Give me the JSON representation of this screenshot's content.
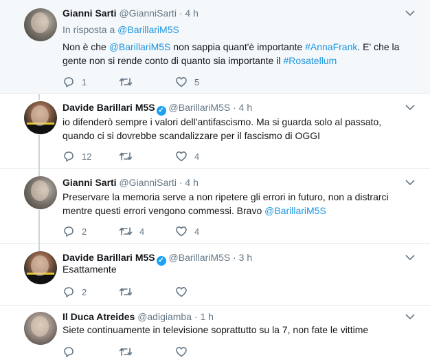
{
  "tweets": [
    {
      "name": "Gianni Sarti",
      "handle": "@GianniSarti",
      "time": "4 h",
      "reply_prefix": "In risposta a",
      "reply_handle": "@BarillariM5S",
      "text_parts": [
        "Non è che ",
        "@BarillariM5S",
        " non sappia quant'è importante ",
        "#AnnaFrank",
        ". E' che la gente non si rende conto di quanto sia importante il ",
        "#Rosatellum"
      ],
      "replies": "1",
      "retweets": "",
      "likes": "5"
    },
    {
      "name": "Davide Barillari M5S",
      "handle": "@BarillariM5S",
      "time": "4 h",
      "text": "io difenderò sempre i valori dell'antifascismo. Ma si guarda solo al passato, quando ci si dovrebbe scandalizzare per il fascismo di OGGI",
      "replies": "12",
      "retweets": "",
      "likes": "4"
    },
    {
      "name": "Gianni Sarti",
      "handle": "@GianniSarti",
      "time": "4 h",
      "text_parts": [
        "Preservare la memoria serve a non ripetere gli errori in futuro, non a distrarci mentre questi errori vengono commessi. Bravo ",
        "@BarillariM5S"
      ],
      "replies": "2",
      "retweets": "4",
      "likes": "4"
    },
    {
      "name": "Davide Barillari M5S",
      "handle": "@BarillariM5S",
      "time": "3 h",
      "text": "Esattamente",
      "replies": "2",
      "retweets": "",
      "likes": ""
    },
    {
      "name": "Il Duca Atreides",
      "handle": "@adigiamba",
      "time": "1 h",
      "text": "Siete continuamente in televisione soprattutto su la 7, non fate le vittime",
      "replies": "",
      "retweets": "",
      "likes": ""
    }
  ],
  "separator": "·",
  "verified_mark": "✓",
  "colors": {
    "link": "#1b95e0",
    "muted": "#657786",
    "verified": "#1da1f2",
    "highlight_bg": "#f5f8fa"
  }
}
